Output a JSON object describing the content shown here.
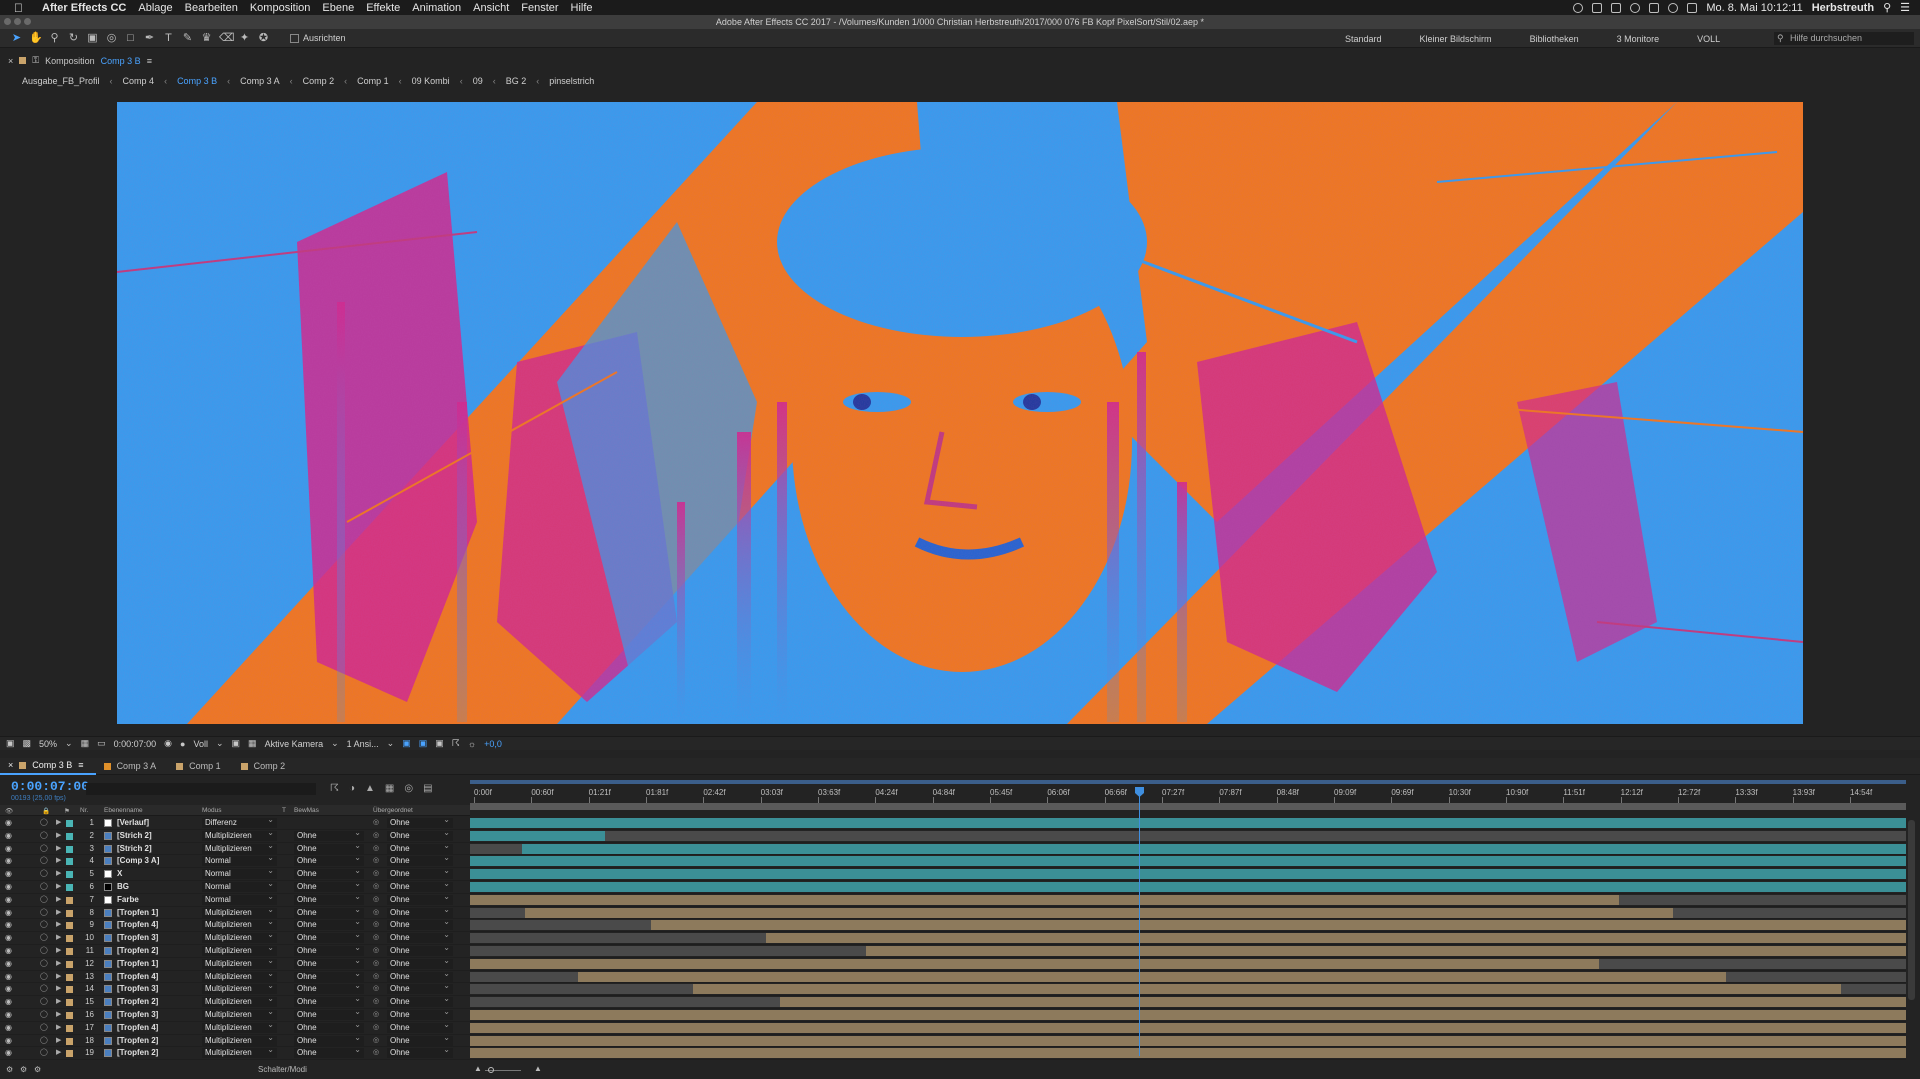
{
  "menubar": {
    "app_name": "After Effects CC",
    "items": [
      "Ablage",
      "Bearbeiten",
      "Komposition",
      "Ebene",
      "Effekte",
      "Animation",
      "Ansicht",
      "Fenster",
      "Hilfe"
    ],
    "clock": "Mo. 8. Mai  10:12:11",
    "user": "Herbstreuth"
  },
  "titlebar": {
    "title": "Adobe After Effects CC 2017 - /Volumes/Kunden 1/000 Christian Herbstreuth/2017/000 076 FB Kopf PixelSort/Stil/02.aep *"
  },
  "toolbar": {
    "align_label": "Ausrichten",
    "workspaces": [
      "Standard",
      "Kleiner Bildschirm",
      "Bibliotheken",
      "3 Monitore",
      "VOLL"
    ],
    "help_placeholder": "Hilfe durchsuchen"
  },
  "comp_panel": {
    "label": "Komposition",
    "comp_name": "Comp 3 B"
  },
  "breadcrumb": [
    "Ausgabe_FB_Profil",
    "Comp 4",
    "Comp 3 B",
    "Comp 3 A",
    "Comp 2",
    "Comp 1",
    "09 Kombi",
    "09",
    "BG 2",
    "pinselstrich"
  ],
  "viewer_footer": {
    "zoom": "50%",
    "timecode": "0:00:07:00",
    "resolution": "Voll",
    "camera": "Aktive Kamera",
    "views": "1 Ansi...",
    "exposure": "+0,0"
  },
  "timeline": {
    "tabs": [
      {
        "label": "Comp 3 B",
        "color": "#c9a36a"
      },
      {
        "label": "Comp 3 A",
        "color": "#e0902a"
      },
      {
        "label": "Comp 1",
        "color": "#c9a36a"
      },
      {
        "label": "Comp 2",
        "color": "#c9a36a"
      }
    ],
    "current_time": "0:00:07:00",
    "fps_info": "00193 (25,00 fps)",
    "columns": {
      "nr": "Nr.",
      "layer_name": "Ebenenname",
      "mode": "Modus",
      "t": "T",
      "trkmat": "BewMas",
      "parent": "Übergeordnet"
    },
    "time_ticks": [
      "0:00f",
      "00:60f",
      "01:21f",
      "01:81f",
      "02:42f",
      "03:03f",
      "03:63f",
      "04:24f",
      "04:84f",
      "05:45f",
      "06:06f",
      "06:66f",
      "07:27f",
      "07:87f",
      "08:48f",
      "09:09f",
      "09:69f",
      "10:30f",
      "10:90f",
      "11:51f",
      "12:12f",
      "12:72f",
      "13:33f",
      "13:93f",
      "14:54f"
    ],
    "footer_label": "Schalter/Modi",
    "layers": [
      {
        "nr": "1",
        "name": "[Verlauf]",
        "mode": "Differenz",
        "trkmat": "",
        "parent": "Ohne",
        "label": "#4ab5b5",
        "icon": "white",
        "bar_color": "#3b8f96",
        "bar_start": 0.0,
        "bar_end": 1.0,
        "gray_start": 0.0
      },
      {
        "nr": "2",
        "name": "[Strich 2]",
        "mode": "Multiplizieren",
        "trkmat": "Ohne",
        "parent": "Ohne",
        "label": "#4ab5b5",
        "icon": "comp",
        "bar_color": "#3b8f96",
        "bar_start": 0.0,
        "bar_end": 0.094,
        "gray_start": 0.0
      },
      {
        "nr": "3",
        "name": "[Strich 2]",
        "mode": "Multiplizieren",
        "trkmat": "Ohne",
        "parent": "Ohne",
        "label": "#4ab5b5",
        "icon": "comp",
        "bar_color": "#3b8f96",
        "bar_start": 0.036,
        "bar_end": 1.0,
        "gray_start": 0.0
      },
      {
        "nr": "4",
        "name": "[Comp 3 A]",
        "mode": "Normal",
        "trkmat": "Ohne",
        "parent": "Ohne",
        "label": "#4ab5b5",
        "icon": "comp",
        "bar_color": "#3b8f96",
        "bar_start": 0.0,
        "bar_end": 1.0,
        "gray_start": 0.0
      },
      {
        "nr": "5",
        "name": "X",
        "mode": "Normal",
        "trkmat": "Ohne",
        "parent": "Ohne",
        "label": "#4ab5b5",
        "icon": "white",
        "bar_color": "#3b8f96",
        "bar_start": 0.0,
        "bar_end": 1.0,
        "gray_start": 0.0
      },
      {
        "nr": "6",
        "name": "BG",
        "mode": "Normal",
        "trkmat": "Ohne",
        "parent": "Ohne",
        "label": "#4ab5b5",
        "icon": "black",
        "bar_color": "#3b8f96",
        "bar_start": 0.0,
        "bar_end": 1.0,
        "gray_start": 0.0
      },
      {
        "nr": "7",
        "name": "Farbe",
        "mode": "Normal",
        "trkmat": "Ohne",
        "parent": "Ohne",
        "label": "#c9a36a",
        "icon": "white",
        "bar_color": "#8d7a5c",
        "bar_start": 0.0,
        "bar_end": 0.8,
        "gray_start": 0.0
      },
      {
        "nr": "8",
        "name": "[Tropfen 1]",
        "mode": "Multiplizieren",
        "trkmat": "Ohne",
        "parent": "Ohne",
        "label": "#c9a36a",
        "icon": "comp",
        "bar_color": "#8d7a5c",
        "bar_start": 0.038,
        "bar_end": 0.838,
        "gray_start": 0.0
      },
      {
        "nr": "9",
        "name": "[Tropfen 4]",
        "mode": "Multiplizieren",
        "trkmat": "Ohne",
        "parent": "Ohne",
        "label": "#c9a36a",
        "icon": "comp",
        "bar_color": "#8d7a5c",
        "bar_start": 0.126,
        "bar_end": 1.0,
        "gray_start": 0.0
      },
      {
        "nr": "10",
        "name": "[Tropfen 3]",
        "mode": "Multiplizieren",
        "trkmat": "Ohne",
        "parent": "Ohne",
        "label": "#c9a36a",
        "icon": "comp",
        "bar_color": "#8d7a5c",
        "bar_start": 0.206,
        "bar_end": 1.0,
        "gray_start": 0.0
      },
      {
        "nr": "11",
        "name": "[Tropfen 2]",
        "mode": "Multiplizieren",
        "trkmat": "Ohne",
        "parent": "Ohne",
        "label": "#c9a36a",
        "icon": "comp",
        "bar_color": "#8d7a5c",
        "bar_start": 0.276,
        "bar_end": 1.0,
        "gray_start": 0.0
      },
      {
        "nr": "12",
        "name": "[Tropfen 1]",
        "mode": "Multiplizieren",
        "trkmat": "Ohne",
        "parent": "Ohne",
        "label": "#c9a36a",
        "icon": "comp",
        "bar_color": "#8d7a5c",
        "bar_start": 0.0,
        "bar_end": 0.786,
        "gray_start": 0.0
      },
      {
        "nr": "13",
        "name": "[Tropfen 4]",
        "mode": "Multiplizieren",
        "trkmat": "Ohne",
        "parent": "Ohne",
        "label": "#c9a36a",
        "icon": "comp",
        "bar_color": "#8d7a5c",
        "bar_start": 0.075,
        "bar_end": 0.875,
        "gray_start": 0.0
      },
      {
        "nr": "14",
        "name": "[Tropfen 3]",
        "mode": "Multiplizieren",
        "trkmat": "Ohne",
        "parent": "Ohne",
        "label": "#c9a36a",
        "icon": "comp",
        "bar_color": "#8d7a5c",
        "bar_start": 0.155,
        "bar_end": 0.955,
        "gray_start": 0.0
      },
      {
        "nr": "15",
        "name": "[Tropfen 2]",
        "mode": "Multiplizieren",
        "trkmat": "Ohne",
        "parent": "Ohne",
        "label": "#c9a36a",
        "icon": "comp",
        "bar_color": "#8d7a5c",
        "bar_start": 0.216,
        "bar_end": 1.0,
        "gray_start": 0.0
      },
      {
        "nr": "16",
        "name": "[Tropfen 3]",
        "mode": "Multiplizieren",
        "trkmat": "Ohne",
        "parent": "Ohne",
        "label": "#c9a36a",
        "icon": "comp",
        "bar_color": "#8d7a5c",
        "bar_start": 0.0,
        "bar_end": 1.0,
        "gray_start": 0.0
      },
      {
        "nr": "17",
        "name": "[Tropfen 4]",
        "mode": "Multiplizieren",
        "trkmat": "Ohne",
        "parent": "Ohne",
        "label": "#c9a36a",
        "icon": "comp",
        "bar_color": "#8d7a5c",
        "bar_start": 0.0,
        "bar_end": 1.0,
        "gray_start": 0.0
      },
      {
        "nr": "18",
        "name": "[Tropfen 2]",
        "mode": "Multiplizieren",
        "trkmat": "Ohne",
        "parent": "Ohne",
        "label": "#c9a36a",
        "icon": "comp",
        "bar_color": "#8d7a5c",
        "bar_start": 0.0,
        "bar_end": 1.0,
        "gray_start": 0.0
      },
      {
        "nr": "19",
        "name": "[Tropfen 2]",
        "mode": "Multiplizieren",
        "trkmat": "Ohne",
        "parent": "Ohne",
        "label": "#c9a36a",
        "icon": "comp",
        "bar_color": "#8d7a5c",
        "bar_start": 0.0,
        "bar_end": 1.0,
        "gray_start": 0.0
      }
    ]
  },
  "colors": {
    "accent": "#4aa3ff",
    "teal_bar": "#3b8f96",
    "tan_bar": "#8d7a5c",
    "canvas_blue": "#2fa0f0",
    "canvas_orange": "#f07a18",
    "canvas_magenta": "#d0288c"
  }
}
